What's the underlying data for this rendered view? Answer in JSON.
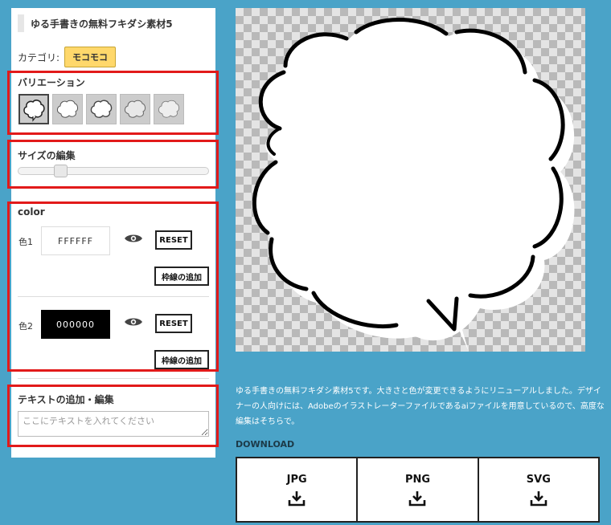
{
  "material": {
    "title": "ゆる手書きの無料フキダシ素材5",
    "category_label": "カテゴリ:",
    "category": "モコモコ"
  },
  "variation": {
    "title": "バリエーション",
    "thumbnails": [
      "variation-1",
      "variation-2",
      "variation-3",
      "variation-4",
      "variation-5"
    ],
    "selected_index": 0
  },
  "size_edit": {
    "title": "サイズの編集",
    "slider_value_fraction": 0.22
  },
  "color": {
    "title": "color",
    "items": [
      {
        "label": "色1",
        "value": "FFFFFF",
        "swatch": "#ffffff",
        "text_color": "#333333",
        "reset": "RESET",
        "add_border": "枠線の追加",
        "visibility_icon": "eye-icon"
      },
      {
        "label": "色2",
        "value": "000000",
        "swatch": "#000000",
        "text_color": "#ffffff",
        "reset": "RESET",
        "add_border": "枠線の追加",
        "visibility_icon": "eye-icon"
      }
    ]
  },
  "text_edit": {
    "title": "テキストの追加・編集",
    "placeholder": "ここにテキストを入れてください"
  },
  "preview": {
    "background": "transparent-checkerboard",
    "fill_color": "#ffffff",
    "stroke_color": "#000000"
  },
  "description": "ゆる手書きの無料フキダシ素材5です。大きさと色が変更できるようにリニューアルしました。デザイナーの人向けには、Adobeのイラストレーターファイルであるaiファイルを用意しているので、高度な編集はそちらで。",
  "download": {
    "heading": "DOWNLOAD",
    "buttons": [
      {
        "label": "JPG",
        "icon": "download-icon"
      },
      {
        "label": "PNG",
        "icon": "download-icon"
      },
      {
        "label": "SVG",
        "icon": "download-icon"
      }
    ]
  },
  "colors": {
    "background": "#4aa3c8",
    "highlight_box": "#e21a1a",
    "category_badge": "#ffd86b"
  }
}
